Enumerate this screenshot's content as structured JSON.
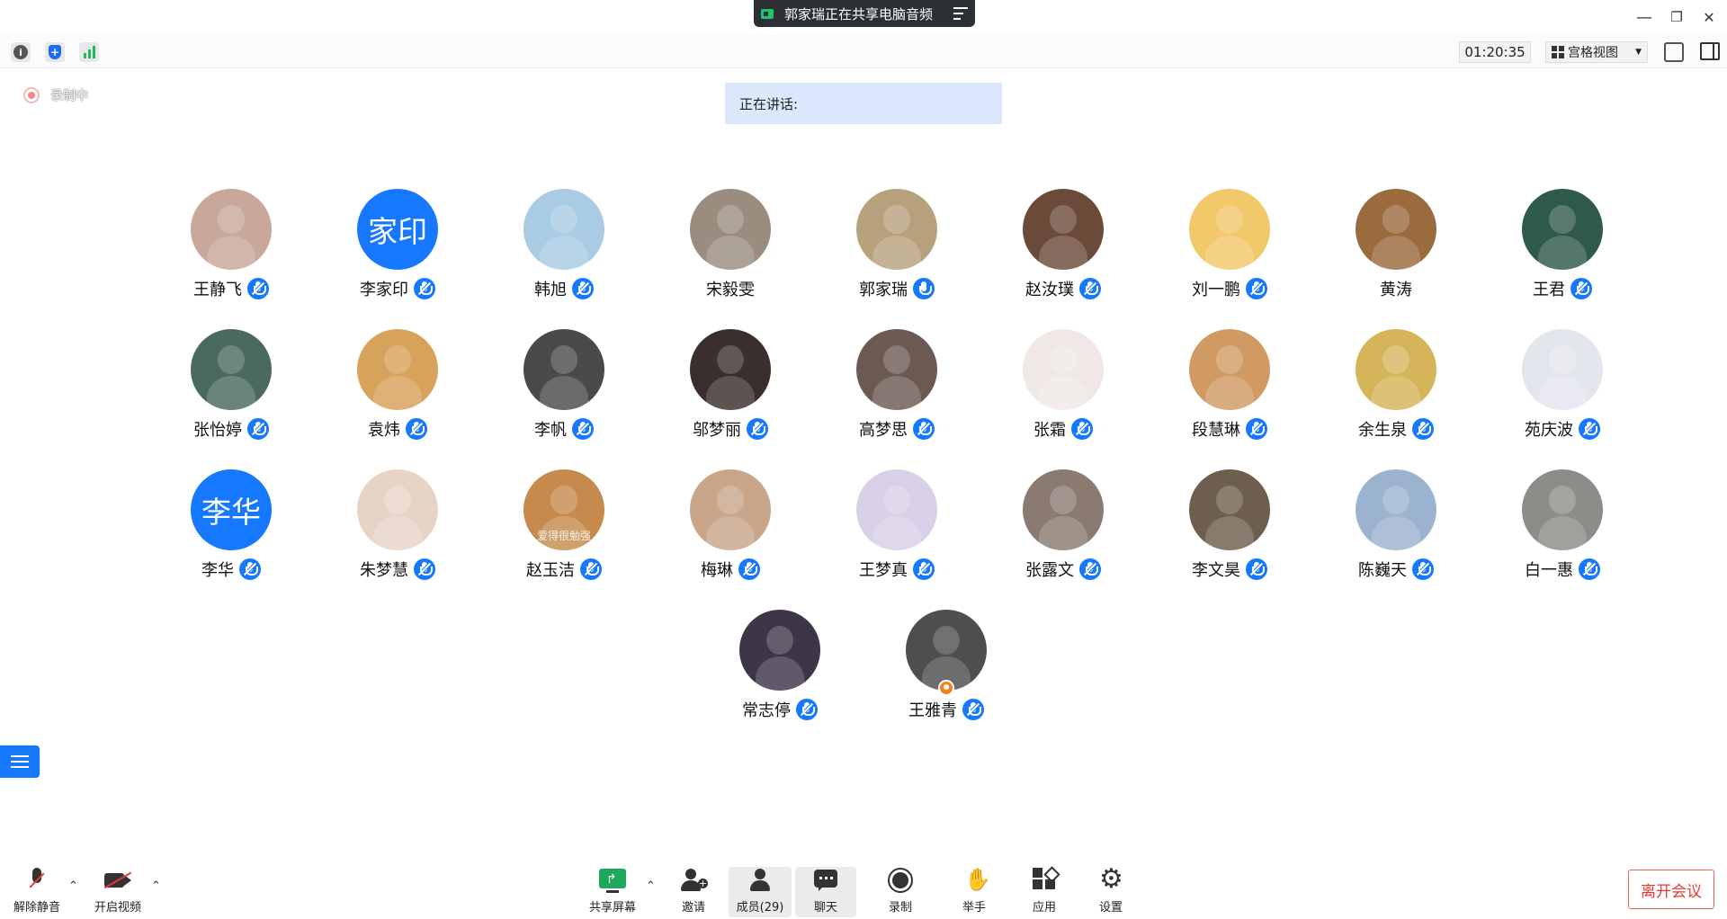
{
  "share_banner": {
    "text": "郭家瑞正在共享电脑音频"
  },
  "window_controls": {
    "minimize": "—",
    "restore": "❐",
    "close": "✕"
  },
  "topbar": {
    "timer": "01:20:35",
    "view_mode": "宫格视图"
  },
  "recording": {
    "label": "录制中"
  },
  "speaking": {
    "label": "正在讲话:"
  },
  "participants": [
    {
      "name": "王静飞",
      "avatar": "photo",
      "color": "#c9a79a",
      "mic": "muted"
    },
    {
      "name": "李家印",
      "avatar": "text",
      "avatar_text": "家印",
      "mic": "muted"
    },
    {
      "name": "韩旭",
      "avatar": "photo",
      "color": "#a9cbe3",
      "mic": "muted"
    },
    {
      "name": "宋毅雯",
      "avatar": "photo",
      "color": "#9a8d80",
      "mic": "none"
    },
    {
      "name": "郭家瑞",
      "avatar": "photo",
      "color": "#b7a17d",
      "mic": "on"
    },
    {
      "name": "赵汝璞",
      "avatar": "photo",
      "color": "#6b4a3a",
      "mic": "muted"
    },
    {
      "name": "刘一鹏",
      "avatar": "photo",
      "color": "#f1c96b",
      "mic": "muted"
    },
    {
      "name": "黄涛",
      "avatar": "photo",
      "color": "#9a6b3c",
      "mic": "none"
    },
    {
      "name": "王君",
      "avatar": "photo",
      "color": "#2f5a4a",
      "mic": "muted"
    },
    {
      "name": "张怡婷",
      "avatar": "photo",
      "color": "#4a6a5e",
      "mic": "muted"
    },
    {
      "name": "袁炜",
      "avatar": "photo",
      "color": "#d7a25a",
      "mic": "muted"
    },
    {
      "name": "李帆",
      "avatar": "photo",
      "color": "#4a4a4a",
      "mic": "muted"
    },
    {
      "name": "邬梦丽",
      "avatar": "photo",
      "color": "#3a2f2c",
      "mic": "muted"
    },
    {
      "name": "高梦思",
      "avatar": "photo",
      "color": "#6c5a52",
      "mic": "muted"
    },
    {
      "name": "张霜",
      "avatar": "photo",
      "color": "#efe8e6",
      "mic": "muted"
    },
    {
      "name": "段慧琳",
      "avatar": "photo",
      "color": "#d09a62",
      "mic": "muted"
    },
    {
      "name": "余生泉",
      "avatar": "photo",
      "color": "#d6b45a",
      "mic": "muted"
    },
    {
      "name": "苑庆波",
      "avatar": "photo",
      "color": "#e4e6ee",
      "mic": "muted"
    },
    {
      "name": "李华",
      "avatar": "text",
      "avatar_text": "李华",
      "mic": "muted"
    },
    {
      "name": "朱梦慧",
      "avatar": "photo",
      "color": "#e8d4c6",
      "mic": "muted"
    },
    {
      "name": "赵玉洁",
      "avatar": "photo",
      "color": "#c58a4c",
      "mic": "muted",
      "overlay": "爱得很勉强"
    },
    {
      "name": "梅琳",
      "avatar": "photo",
      "color": "#c9a58a",
      "mic": "muted"
    },
    {
      "name": "王梦真",
      "avatar": "photo",
      "color": "#d8d0e6",
      "mic": "muted"
    },
    {
      "name": "张露文",
      "avatar": "photo",
      "color": "#8a7a70",
      "mic": "muted"
    },
    {
      "name": "李文昊",
      "avatar": "photo",
      "color": "#6d5e4e",
      "mic": "muted"
    },
    {
      "name": "陈巍天",
      "avatar": "photo",
      "color": "#9cb3cf",
      "mic": "muted"
    },
    {
      "name": "白一惠",
      "avatar": "photo",
      "color": "#8c8c88",
      "mic": "muted"
    },
    {
      "name": "常志停",
      "avatar": "photo",
      "color": "#3e3548",
      "mic": "muted"
    },
    {
      "name": "王雅青",
      "avatar": "photo",
      "color": "#4e4e4e",
      "mic": "muted",
      "host": true
    }
  ],
  "bottombar": {
    "unmute": "解除静音",
    "start_video": "开启视频",
    "share_screen": "共享屏幕",
    "invite": "邀请",
    "members": "成员(29)",
    "chat": "聊天",
    "record": "录制",
    "raise_hand": "举手",
    "apps": "应用",
    "settings": "设置",
    "leave": "离开会议"
  },
  "colors": {
    "accent": "#1677ff",
    "leave": "#e53935",
    "share_green": "#1fa85b"
  }
}
